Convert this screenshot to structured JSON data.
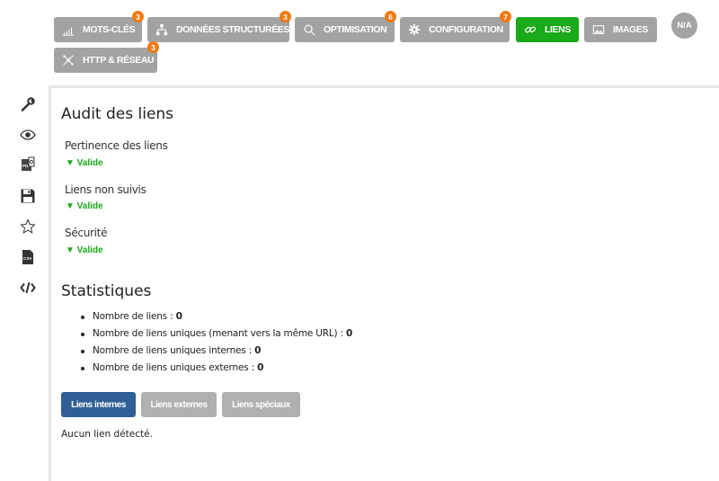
{
  "tabs": [
    {
      "label": "MOTS-CLÉS",
      "badge": "3",
      "icon": "bar-chart-icon"
    },
    {
      "label": "DONNÉES STRUCTURÉES",
      "badge": "3",
      "icon": "sitemap-icon"
    },
    {
      "label": "OPTIMISATION",
      "badge": "6",
      "icon": "search-icon"
    },
    {
      "label": "CONFIGURATION",
      "badge": "7",
      "icon": "gear-icon"
    },
    {
      "label": "LIENS",
      "badge": "",
      "icon": "link-icon",
      "active": true
    },
    {
      "label": "IMAGES",
      "badge": "",
      "icon": "image-icon"
    },
    {
      "label": "HTTP & RÉSEAU",
      "badge": "3",
      "icon": "network-icon"
    }
  ],
  "avatar": {
    "label": "N/A"
  },
  "sidebar": [
    "wrench-icon",
    "eye-icon",
    "pdf-icon",
    "save-icon",
    "star-icon",
    "csv-icon",
    "code-icon"
  ],
  "audit": {
    "title": "Audit des liens",
    "checks": [
      {
        "label": "Pertinence des liens",
        "status": "▼ Valide"
      },
      {
        "label": "Liens non suivis",
        "status": "▼ Valide"
      },
      {
        "label": "Sécurité",
        "status": "▼ Valide"
      }
    ]
  },
  "stats": {
    "title": "Statistiques",
    "items": [
      {
        "label": "Nombre de liens : ",
        "value": "0"
      },
      {
        "label": "Nombre de liens uniques (menant vers la même URL) : ",
        "value": "0"
      },
      {
        "label": "Nombre de liens uniques internes : ",
        "value": "0"
      },
      {
        "label": "Nombre de liens uniques externes : ",
        "value": "0"
      }
    ]
  },
  "link_buttons": [
    "Liens internes",
    "Liens externes",
    "Liens spéciaux"
  ],
  "empty_message": "Aucun lien détecté.",
  "colors": {
    "active_tab": "#19a919",
    "inactive_tab": "#a3a3a3",
    "badge": "#ee7a12",
    "primary_button": "#2f5f95",
    "valid": "#19a919"
  }
}
